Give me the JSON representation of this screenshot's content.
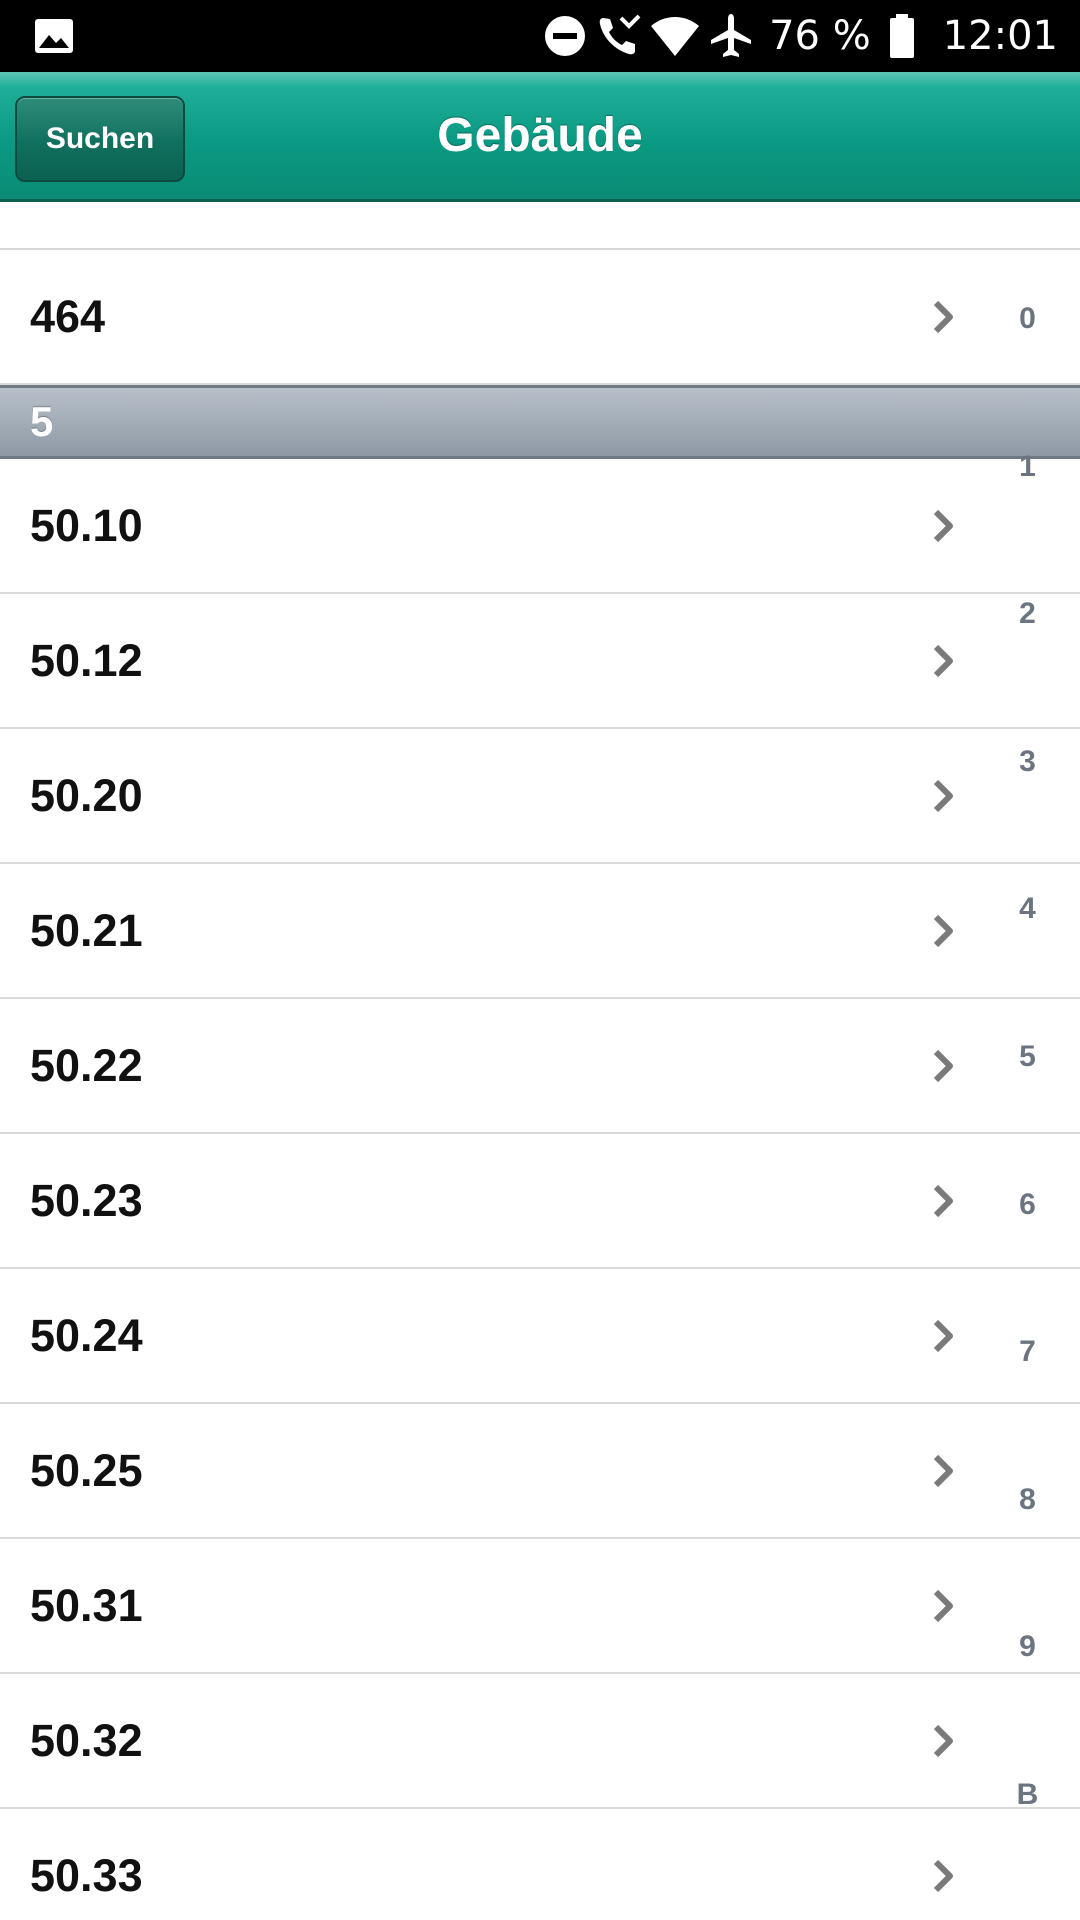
{
  "status_bar": {
    "icons": [
      "gallery-icon",
      "do-not-disturb-icon",
      "wifi-calling-icon",
      "wifi-icon",
      "airplane-mode-icon",
      "battery-icon"
    ],
    "battery_percent": "76 %",
    "time": "12:01"
  },
  "header": {
    "search_button_label": "Suchen",
    "title": "Gebäude"
  },
  "list": {
    "item_before_section": "464",
    "section_title": "5",
    "items": [
      "50.10",
      "50.12",
      "50.20",
      "50.21",
      "50.22",
      "50.23",
      "50.24",
      "50.25",
      "50.31",
      "50.32",
      "50.33"
    ]
  },
  "index_bar": {
    "letters": [
      "0",
      "1",
      "2",
      "3",
      "4",
      "5",
      "6",
      "7",
      "8",
      "9",
      "B"
    ]
  },
  "colors": {
    "header_teal": "#0a9a83",
    "section_header_gray": "#a3adb8",
    "index_text": "#6b7480"
  }
}
